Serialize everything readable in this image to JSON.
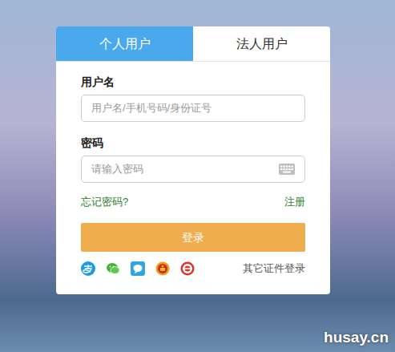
{
  "tabs": [
    {
      "label": "个人用户",
      "selected": true
    },
    {
      "label": "法人用户",
      "selected": false
    }
  ],
  "fields": [
    {
      "label": "用户名",
      "placeholder": "用户名/手机号码/身份证号",
      "kind": "text"
    },
    {
      "label": "密码",
      "placeholder": "请输入密码",
      "kind": "password"
    }
  ],
  "links": {
    "forgot": "忘记密码?",
    "register": "注册"
  },
  "login_button": "登录",
  "other_login": "其它证件登录",
  "watermark": "husay.cn"
}
